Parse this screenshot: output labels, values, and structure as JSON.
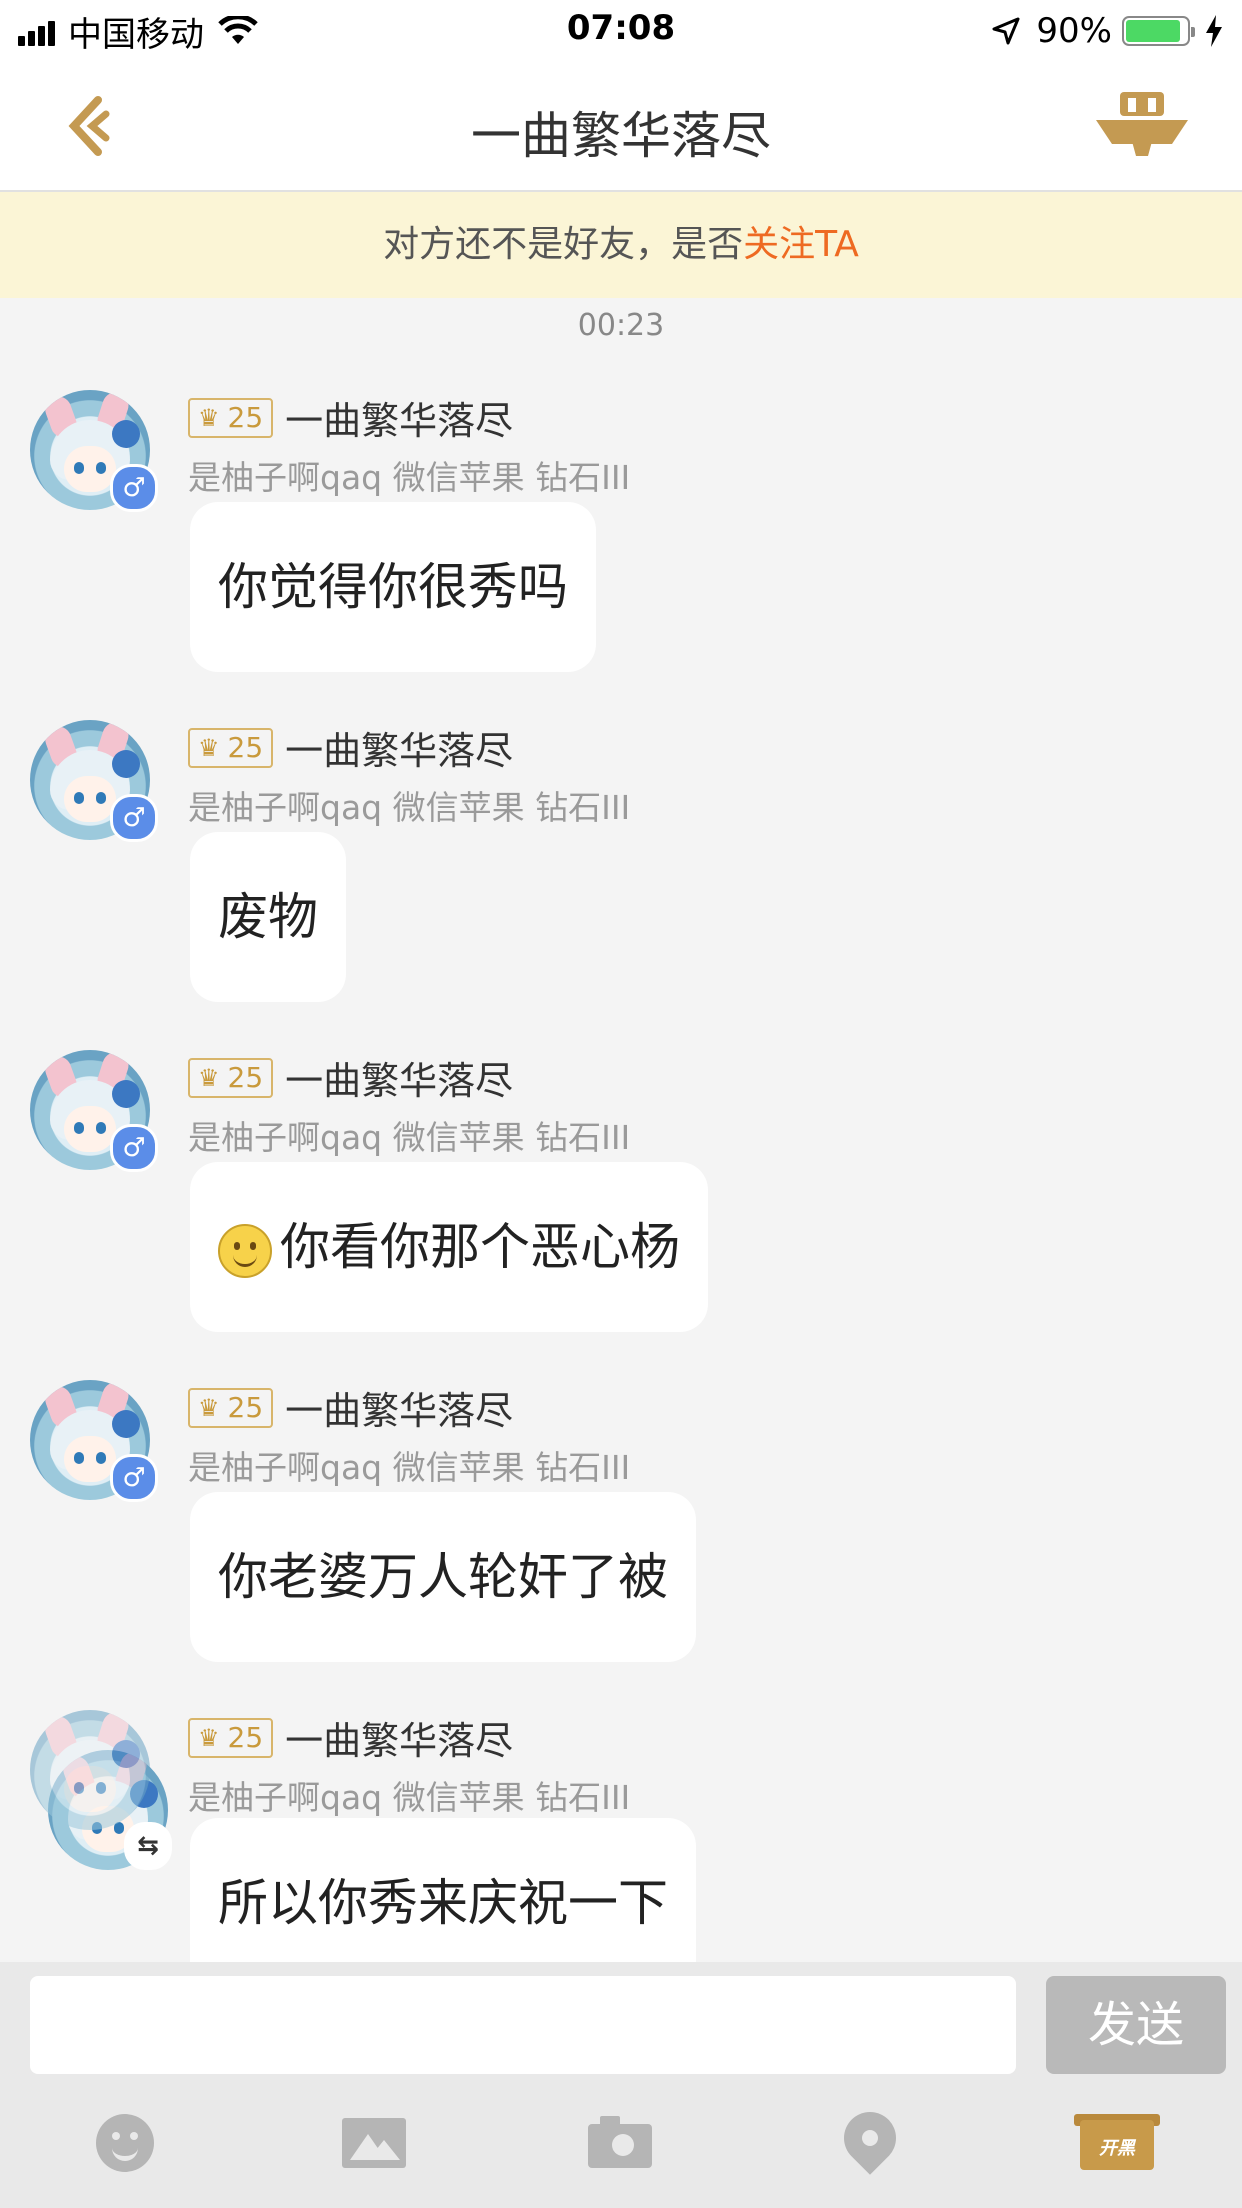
{
  "status_bar": {
    "carrier": "中国移动",
    "time": "07:08",
    "battery_percent": "90%",
    "battery_level": 0.9
  },
  "nav": {
    "title": "一曲繁华落尽",
    "back_icon": "chevron-left-icon",
    "action_icon": "team-icon"
  },
  "banner": {
    "text": "对方还不是好友，是否",
    "link": "关注TA",
    "link_color": "#ee6a22"
  },
  "timestamp": "00:23",
  "messages": [
    {
      "level": "25",
      "name": "一曲繁华落尽",
      "sub": "是柚子啊qaq 微信苹果 钻石III",
      "text": "你觉得你很秀吗",
      "badge": "♂"
    },
    {
      "level": "25",
      "name": "一曲繁华落尽",
      "sub": "是柚子啊qaq 微信苹果 钻石III",
      "text": "废物",
      "badge": "♂"
    },
    {
      "level": "25",
      "name": "一曲繁华落尽",
      "sub": "是柚子啊qaq 微信苹果 钻石III",
      "text": "你看你那个恶心杨",
      "badge": "♂",
      "emoji": "smile-emoji"
    },
    {
      "level": "25",
      "name": "一曲繁华落尽",
      "sub": "是柚子啊qaq 微信苹果 钻石III",
      "text": "你老婆万人轮奸了被",
      "badge": "♂"
    },
    {
      "level": "25",
      "name": "一曲繁华落尽",
      "sub": "是柚子啊qaq 微信苹果 钻石III",
      "text": "所以你秀来庆祝一下",
      "badge": "⇆"
    }
  ],
  "composer": {
    "input_value": "",
    "send_label": "发送",
    "tools": [
      "emoji-icon",
      "image-icon",
      "camera-icon",
      "location-icon",
      "kaihei-icon"
    ],
    "kaihei_label": "开黑"
  }
}
